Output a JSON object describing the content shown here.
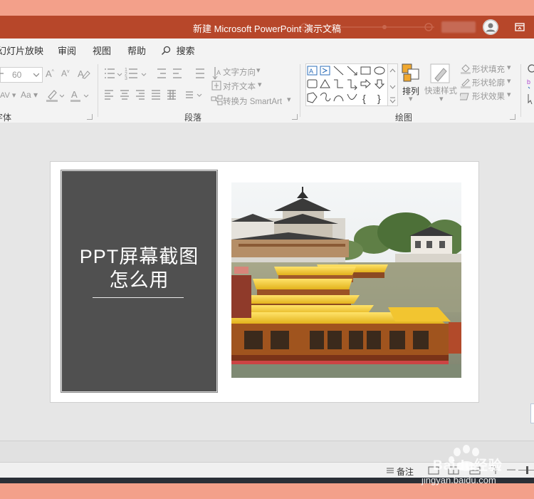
{
  "window": {
    "title": "新建 Microsoft PowerPoint 演示文稿"
  },
  "menu": {
    "items": [
      "幻灯片放映",
      "审阅",
      "视图",
      "帮助"
    ],
    "search_label": "搜索"
  },
  "ribbon": {
    "font": {
      "size_value": "60",
      "group_label": "字体"
    },
    "paragraph": {
      "text_direction": "文字方向",
      "align_text": "对齐文本",
      "convert_smartart": "转换为 SmartArt",
      "group_label": "段落"
    },
    "drawing": {
      "arrange": "排列",
      "quick_styles": "快速样式",
      "shape_fill": "形状填充",
      "shape_outline": "形状轮廓",
      "shape_effects": "形状效果",
      "group_label": "绘图"
    }
  },
  "slide": {
    "title_line1": "PPT屏幕截图",
    "title_line2": "怎么用"
  },
  "status": {
    "notes_label": "备注",
    "zoom_minus": "—"
  },
  "watermark": {
    "brand": "Baidu经验",
    "url": "jingyan.baidu.com"
  },
  "colors": {
    "accent": "#b7472a",
    "page_bg": "#f3a08a",
    "ribbon_bg": "#f3f3f3",
    "canvas_bg": "#e6e6e6",
    "textbox_bg": "#505050"
  }
}
